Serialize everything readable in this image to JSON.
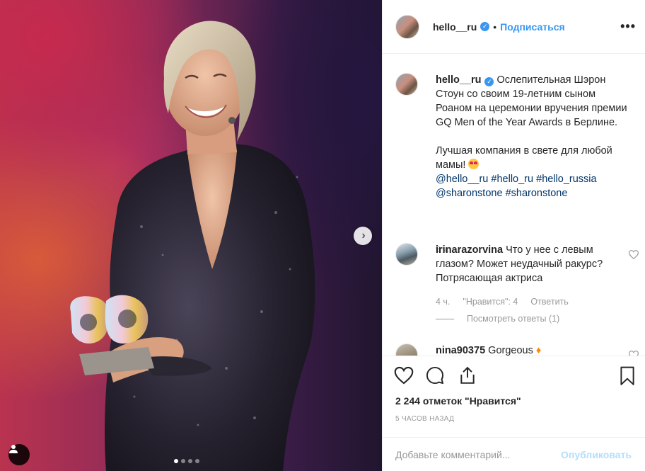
{
  "photo": {
    "next_icon": "chevron-right-icon",
    "user_tag_icon": "user-icon",
    "carousel": {
      "count": 4,
      "current": 1
    }
  },
  "header": {
    "username": "hello__ru",
    "verified_icon": "verified-badge-icon",
    "separator": "•",
    "follow_label": "Подписаться",
    "more_icon": "more-horizontal-icon"
  },
  "caption": {
    "username": "hello__ru",
    "text_line1": "Ослепительная Шэрон Стоун со своим 19-летним сыном Роаном на церемонии вручения премии GQ Men of the Year Awards в Берлине.",
    "text_line2": "Лучшая компания в свете для любой мамы!",
    "emoji": "heart-eyes-emoji",
    "tags": [
      "@hello__ru",
      "#hello_ru",
      "#hello_russia",
      "@sharonstone",
      "#sharonstone"
    ],
    "time": "5 ч."
  },
  "comments": [
    {
      "username": "irinarazorvina",
      "text": "Что у нее с левым глазом? Может неудачный ракурс? Потрясающая актриса",
      "time": "4 ч.",
      "likes_label": "\"Нравится\": 4",
      "reply_label": "Ответить",
      "replies_label": "Посмотреть ответы (1)"
    },
    {
      "username": "nina90375",
      "text": "Gorgeous"
    }
  ],
  "actions": {
    "likes": "2 244 отметок \"Нравится\"",
    "ago": "5 ЧАСОВ НАЗАД"
  },
  "add_comment": {
    "placeholder": "Добавьте комментарий...",
    "post_label": "Опубликовать"
  },
  "colors": {
    "accent": "#3897f0",
    "tag_link": "#003569",
    "post_disabled": "#b2dffc"
  }
}
